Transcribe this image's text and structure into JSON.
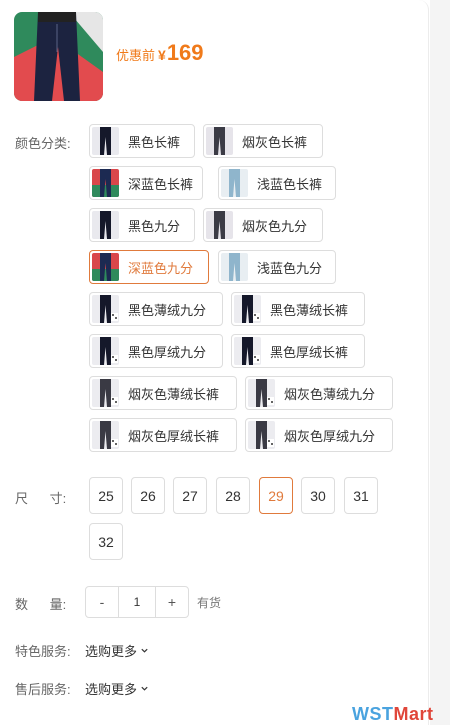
{
  "product": {
    "price_label": "优惠前",
    "price_symbol": "¥",
    "price_value": "169"
  },
  "color": {
    "label": "颜色分类:",
    "options": [
      {
        "label": "黑色长裤",
        "thumb": "dark",
        "selected": false
      },
      {
        "label": "烟灰色长裤",
        "thumb": "grey",
        "selected": false
      },
      {
        "label": "深蓝色长裤",
        "thumb": "navy-red",
        "selected": false
      },
      {
        "label": "浅蓝色长裤",
        "thumb": "light",
        "selected": false
      },
      {
        "label": "黑色九分",
        "thumb": "dark",
        "selected": false
      },
      {
        "label": "烟灰色九分",
        "thumb": "grey",
        "selected": false
      },
      {
        "label": "深蓝色九分",
        "thumb": "navy-red",
        "selected": true
      },
      {
        "label": "浅蓝色九分",
        "thumb": "light",
        "selected": false
      },
      {
        "label": "黑色薄绒九分",
        "thumb": "dark-swatch",
        "selected": false
      },
      {
        "label": "黑色薄绒长裤",
        "thumb": "dark-swatch",
        "selected": false
      },
      {
        "label": "黑色厚绒九分",
        "thumb": "dark-swatch",
        "selected": false
      },
      {
        "label": "黑色厚绒长裤",
        "thumb": "dark-swatch",
        "selected": false
      },
      {
        "label": "烟灰色薄绒长裤",
        "thumb": "grey-swatch",
        "selected": false
      },
      {
        "label": "烟灰色薄绒九分",
        "thumb": "grey-swatch",
        "selected": false
      },
      {
        "label": "烟灰色厚绒长裤",
        "thumb": "grey-swatch",
        "selected": false
      },
      {
        "label": "烟灰色厚绒九分",
        "thumb": "grey-swatch",
        "selected": false
      }
    ]
  },
  "size": {
    "label": "尺      寸:",
    "options": [
      {
        "label": "25",
        "selected": false
      },
      {
        "label": "26",
        "selected": false
      },
      {
        "label": "27",
        "selected": false
      },
      {
        "label": "28",
        "selected": false
      },
      {
        "label": "29",
        "selected": true
      },
      {
        "label": "30",
        "selected": false
      },
      {
        "label": "31",
        "selected": false
      },
      {
        "label": "32",
        "selected": false
      }
    ]
  },
  "quantity": {
    "label": "数      量:",
    "minus": "-",
    "value": "1",
    "plus": "+",
    "stock": "有货"
  },
  "services": {
    "special_label": "特色服务:",
    "special_value": "选购更多",
    "after_label": "售后服务:",
    "after_value": "选购更多"
  },
  "watermark": {
    "part1": "WST",
    "part2": "Mart",
    "colors": {
      "part1": "#4aa3df",
      "part2": "#e0463a"
    }
  },
  "colors": {
    "accent": "#f07a1a",
    "selected_border": "#e07a3c"
  }
}
